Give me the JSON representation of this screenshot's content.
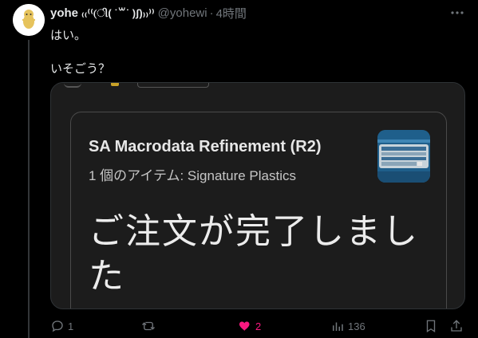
{
  "tweet": {
    "name": "yohe",
    "name_emoji": "₍₍⁽⁽(ી( ˙꒳˙ )ʃ)₎₎⁾⁾",
    "handle": "@yohewi",
    "separator": "·",
    "time": "4時間",
    "lines": [
      "はい。",
      "いそごう？"
    ]
  },
  "card": {
    "title": "SA Macrodata Refinement (R2)",
    "subtitle": "1 個のアイテム: Signature Plastics",
    "message": "ご注文が完了しました"
  },
  "actions": {
    "reply_count": "1",
    "retweet_count": "",
    "like_count": "2",
    "views_count": "136"
  },
  "colors": {
    "background": "#000000",
    "text": "#e7e9ea",
    "muted": "#71767b",
    "like": "#f91880"
  },
  "icons": [
    "more-icon",
    "reply-icon",
    "retweet-icon",
    "like-icon",
    "views-icon",
    "bookmark-icon",
    "share-icon"
  ]
}
